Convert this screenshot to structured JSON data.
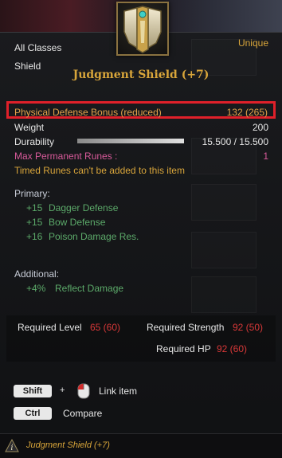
{
  "item": {
    "classes": "All Classes",
    "type": "Shield",
    "rarity": "Unique",
    "name": "Judgment Shield (+7)"
  },
  "stats": {
    "physical_defense_label": "Physical Defense Bonus (reduced)",
    "physical_defense_value": "132 (265)",
    "weight_label": "Weight",
    "weight_value": "200",
    "durability_label": "Durability",
    "durability_value": "15.500 / 15.500",
    "durability_fraction": 1.0,
    "runes_label": "Max Permanent Runes :",
    "runes_value": "1",
    "timed_runes_notice": "Timed Runes can't be added to this item"
  },
  "primary": {
    "heading": "Primary:",
    "lines": [
      {
        "amount": "+15",
        "name": "Dagger Defense"
      },
      {
        "amount": "+15",
        "name": "Bow Defense"
      },
      {
        "amount": "+16",
        "name": "Poison Damage Res."
      }
    ]
  },
  "additional": {
    "heading": "Additional:",
    "lines": [
      {
        "amount": "+4%",
        "name": "Reflect Damage"
      }
    ]
  },
  "requirements": {
    "level_label": "Required Level",
    "level_value": "65 (60)",
    "strength_label": "Required Strength",
    "strength_value": "92 (50)",
    "hp_label": "Required HP",
    "hp_value": "92 (60)"
  },
  "hints": {
    "shift_key": "Shift",
    "plus": "+",
    "link_label": "Link item",
    "ctrl_key": "Ctrl",
    "compare_label": "Compare"
  },
  "footer": {
    "item_name": "Judgment Shield (+7)"
  },
  "colors": {
    "gold": "#d8a53a",
    "highlight_red": "#e0202a",
    "stat_green": "#5caa6a",
    "rune_pink": "#d85a9a",
    "requirement_red": "#d83838"
  }
}
